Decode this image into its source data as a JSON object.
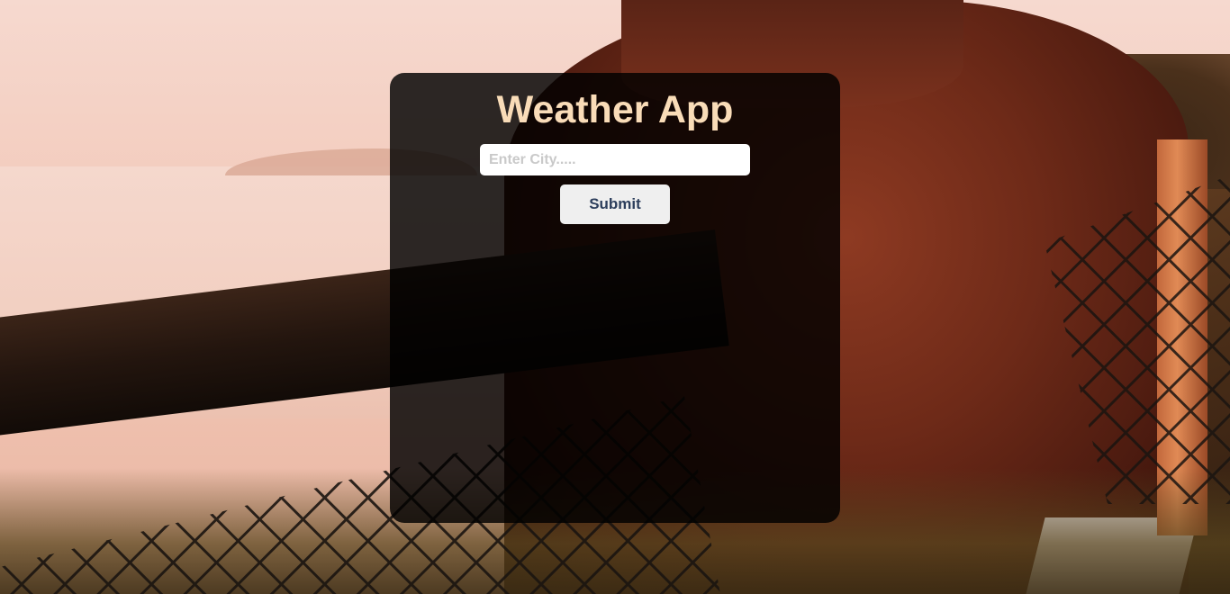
{
  "app": {
    "title": "Weather App"
  },
  "search": {
    "placeholder": "Enter City.....",
    "value": ""
  },
  "actions": {
    "submit_label": "Submit"
  },
  "colors": {
    "title": "#f9dcb8",
    "card_background": "rgba(0,0,0,0.82)",
    "button_text": "#2c3e5c",
    "button_background": "#efefef"
  }
}
